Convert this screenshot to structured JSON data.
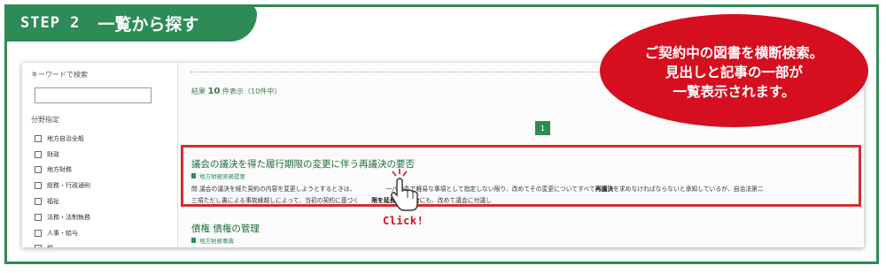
{
  "step": {
    "label": "STEP 2",
    "title": "一覧から探す"
  },
  "callout": {
    "lines": [
      "ご契約中の図書を横断検索。",
      "見出しと記事の一部が",
      "一覧表示されます。"
    ]
  },
  "sidebar": {
    "keyword_label": "キーワードで検索",
    "keyword_value": "",
    "field_label": "分野指定",
    "fields": [
      "地方自治全般",
      "財政",
      "地方財務",
      "総務・行政通則",
      "福祉",
      "法務・法制執務",
      "人事・給与",
      "税"
    ]
  },
  "results": {
    "count_prefix": "結果",
    "count_num": "10",
    "count_suffix": "件表示（10件中）",
    "page": "1",
    "items": [
      {
        "title": "議会の議決を得た履行期限の変更に伴う再議決の要否",
        "source": "地方財務実務提要",
        "snippet": {
          "line1_a": "問 議会の議決を経た契約の内容を変更しようとするときは、",
          "line1_b": "一八〇条で軽易な事項として指定しない限り、改めてその変更についてすべて",
          "line1_c": "再議決",
          "line1_d": "を求めなければならないと承知しているが、自治法第二",
          "line2_a": "三項ただし書による事故繰越しによって、当初の契約に基づく",
          "line2_b": "限を",
          "line2_c": "延長する場合",
          "line2_d": "にも、改めて議会に付議し"
        }
      },
      {
        "title": "債権 債権の管理",
        "source": "地方財務事典"
      }
    ]
  },
  "click_label": "Click!",
  "colors": {
    "brand_green": "#2e8b57",
    "highlight_red": "#d42e2e",
    "callout_red": "#d50f1f"
  },
  "icons": [
    "book-icon",
    "hand-pointer-icon",
    "checkbox-icon"
  ]
}
